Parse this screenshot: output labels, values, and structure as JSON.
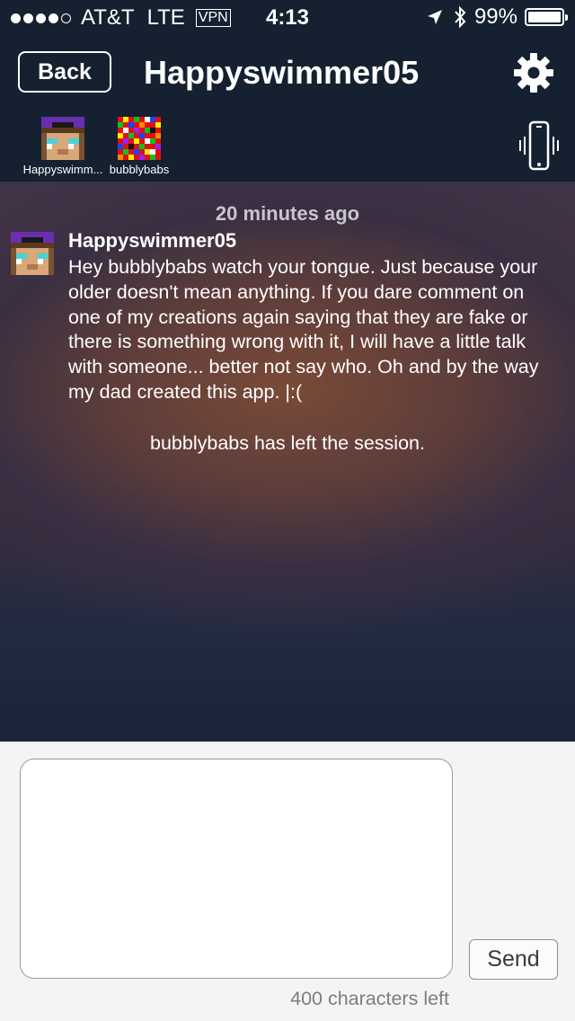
{
  "status_bar": {
    "carrier": "AT&T",
    "network": "LTE",
    "vpn": "VPN",
    "time": "4:13",
    "battery": "99%",
    "battery_level": 0.99,
    "signal_bars_filled": 4,
    "signal_bars_total": 5,
    "icons": [
      "location-arrow-icon",
      "bluetooth-icon",
      "battery-icon"
    ]
  },
  "nav": {
    "back_label": "Back",
    "title": "Happyswimmer05",
    "settings_icon": "gear-icon"
  },
  "participants": [
    {
      "name": "Happyswimm...",
      "avatar": "purple-hat-pixel-avatar"
    },
    {
      "name": "bubblybabs",
      "avatar": "rainbow-pixel-avatar"
    }
  ],
  "vibrate_icon": "phone-vibrate-icon",
  "chat": {
    "timestamp": "20 minutes ago",
    "message": {
      "author": "Happyswimmer05",
      "text": "Hey bubblybabs watch your tongue. Just because your older doesn't mean anything. If you dare comment on one of my creations again saying that they are fake or there is something wrong with it, I will have a little talk with someone... better not say who. Oh and by the way my dad created this app. |:("
    },
    "system_message": "bubblybabs has left the session."
  },
  "composer": {
    "input_value": "",
    "send_label": "Send",
    "chars_left": "400 characters left"
  },
  "colors": {
    "nav_bg": "#152130",
    "composer_bg": "#f4f4f4"
  }
}
